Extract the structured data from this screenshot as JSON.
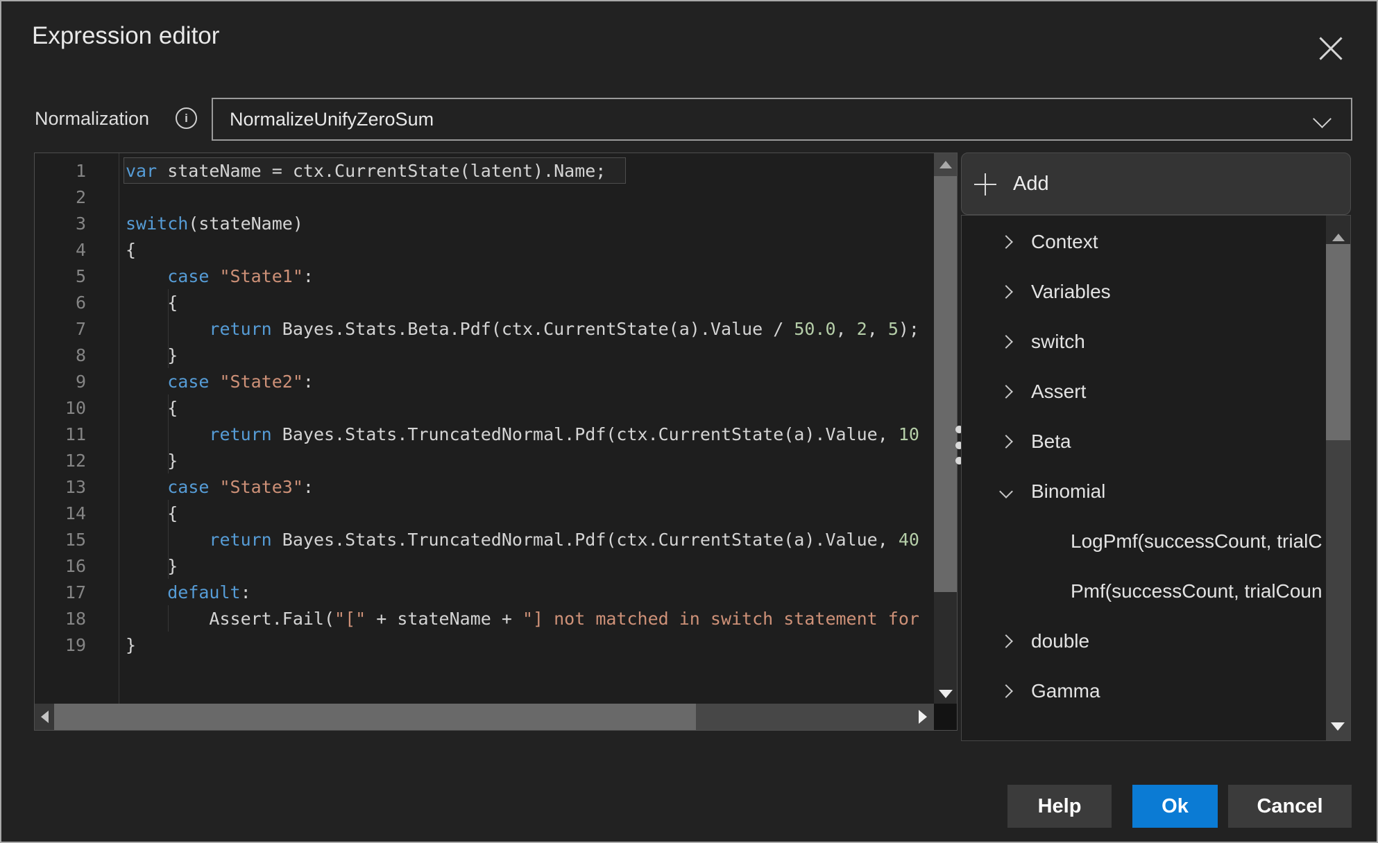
{
  "dialog": {
    "title": "Expression editor"
  },
  "icons": {
    "close": "x-cross",
    "info": "i",
    "add": "+",
    "collapsed": "chevron-right",
    "expanded": "chevron-down"
  },
  "colors": {
    "dialog_bg": "#222222",
    "editor_bg": "#1e1e1e",
    "accent_blue": "#0b7bd4",
    "keyword": "#569cd6",
    "string": "#ce9178",
    "number": "#b5cea8",
    "code_text": "#d4d4d4",
    "line_number": "#858585",
    "button_gray": "#3b3b3b"
  },
  "normalization": {
    "label": "Normalization",
    "value": "NormalizeUnifyZeroSum"
  },
  "editor": {
    "lines": [
      {
        "num": "1",
        "tokens": [
          [
            "kw",
            "var"
          ],
          [
            "pl",
            " stateName = ctx.CurrentState(latent).Name;"
          ]
        ],
        "current": true
      },
      {
        "num": "2",
        "tokens": []
      },
      {
        "num": "3",
        "tokens": [
          [
            "kw",
            "switch"
          ],
          [
            "pl",
            "(stateName)"
          ]
        ]
      },
      {
        "num": "4",
        "tokens": [
          [
            "pl",
            "{"
          ]
        ]
      },
      {
        "num": "5",
        "tokens": [
          [
            "pl",
            "    "
          ],
          [
            "kw",
            "case"
          ],
          [
            "pl",
            " "
          ],
          [
            "str",
            "\"State1\""
          ],
          [
            "pl",
            ":"
          ]
        ]
      },
      {
        "num": "6",
        "tokens": [
          [
            "pl",
            "    {"
          ]
        ]
      },
      {
        "num": "7",
        "tokens": [
          [
            "pl",
            "        "
          ],
          [
            "kw",
            "return"
          ],
          [
            "pl",
            " Bayes.Stats.Beta.Pdf(ctx.CurrentState(a).Value / "
          ],
          [
            "num",
            "50.0"
          ],
          [
            "pl",
            ", "
          ],
          [
            "num",
            "2"
          ],
          [
            "pl",
            ", "
          ],
          [
            "num",
            "5"
          ],
          [
            "pl",
            ");"
          ]
        ]
      },
      {
        "num": "8",
        "tokens": [
          [
            "pl",
            "    }"
          ]
        ]
      },
      {
        "num": "9",
        "tokens": [
          [
            "pl",
            "    "
          ],
          [
            "kw",
            "case"
          ],
          [
            "pl",
            " "
          ],
          [
            "str",
            "\"State2\""
          ],
          [
            "pl",
            ":"
          ]
        ]
      },
      {
        "num": "10",
        "tokens": [
          [
            "pl",
            "    {"
          ]
        ]
      },
      {
        "num": "11",
        "tokens": [
          [
            "pl",
            "        "
          ],
          [
            "kw",
            "return"
          ],
          [
            "pl",
            " Bayes.Stats.TruncatedNormal.Pdf(ctx.CurrentState(a).Value, "
          ],
          [
            "num",
            "10"
          ]
        ]
      },
      {
        "num": "12",
        "tokens": [
          [
            "pl",
            "    }"
          ]
        ]
      },
      {
        "num": "13",
        "tokens": [
          [
            "pl",
            "    "
          ],
          [
            "kw",
            "case"
          ],
          [
            "pl",
            " "
          ],
          [
            "str",
            "\"State3\""
          ],
          [
            "pl",
            ":"
          ]
        ]
      },
      {
        "num": "14",
        "tokens": [
          [
            "pl",
            "    {"
          ]
        ]
      },
      {
        "num": "15",
        "tokens": [
          [
            "pl",
            "        "
          ],
          [
            "kw",
            "return"
          ],
          [
            "pl",
            " Bayes.Stats.TruncatedNormal.Pdf(ctx.CurrentState(a).Value, "
          ],
          [
            "num",
            "40"
          ]
        ]
      },
      {
        "num": "16",
        "tokens": [
          [
            "pl",
            "    }"
          ]
        ]
      },
      {
        "num": "17",
        "tokens": [
          [
            "pl",
            "    "
          ],
          [
            "kw",
            "default"
          ],
          [
            "pl",
            ":"
          ]
        ]
      },
      {
        "num": "18",
        "tokens": [
          [
            "pl",
            "        Assert.Fail("
          ],
          [
            "str",
            "\"[\""
          ],
          [
            "pl",
            " + stateName + "
          ],
          [
            "str",
            "\"] not matched in switch statement for"
          ]
        ]
      },
      {
        "num": "19",
        "tokens": [
          [
            "pl",
            "}"
          ]
        ]
      }
    ]
  },
  "panel": {
    "add_label": "Add",
    "items": [
      {
        "label": "Context",
        "state": "collapsed"
      },
      {
        "label": "Variables",
        "state": "collapsed"
      },
      {
        "label": "switch",
        "state": "collapsed"
      },
      {
        "label": "Assert",
        "state": "collapsed"
      },
      {
        "label": "Beta",
        "state": "collapsed"
      },
      {
        "label": "Binomial",
        "state": "expanded"
      },
      {
        "label": "LogPmf(successCount, trialC",
        "child": true
      },
      {
        "label": "Pmf(successCount, trialCoun",
        "child": true
      },
      {
        "label": "double",
        "state": "collapsed"
      },
      {
        "label": "Gamma",
        "state": "collapsed"
      }
    ]
  },
  "footer": {
    "help": "Help",
    "ok": "Ok",
    "cancel": "Cancel"
  }
}
